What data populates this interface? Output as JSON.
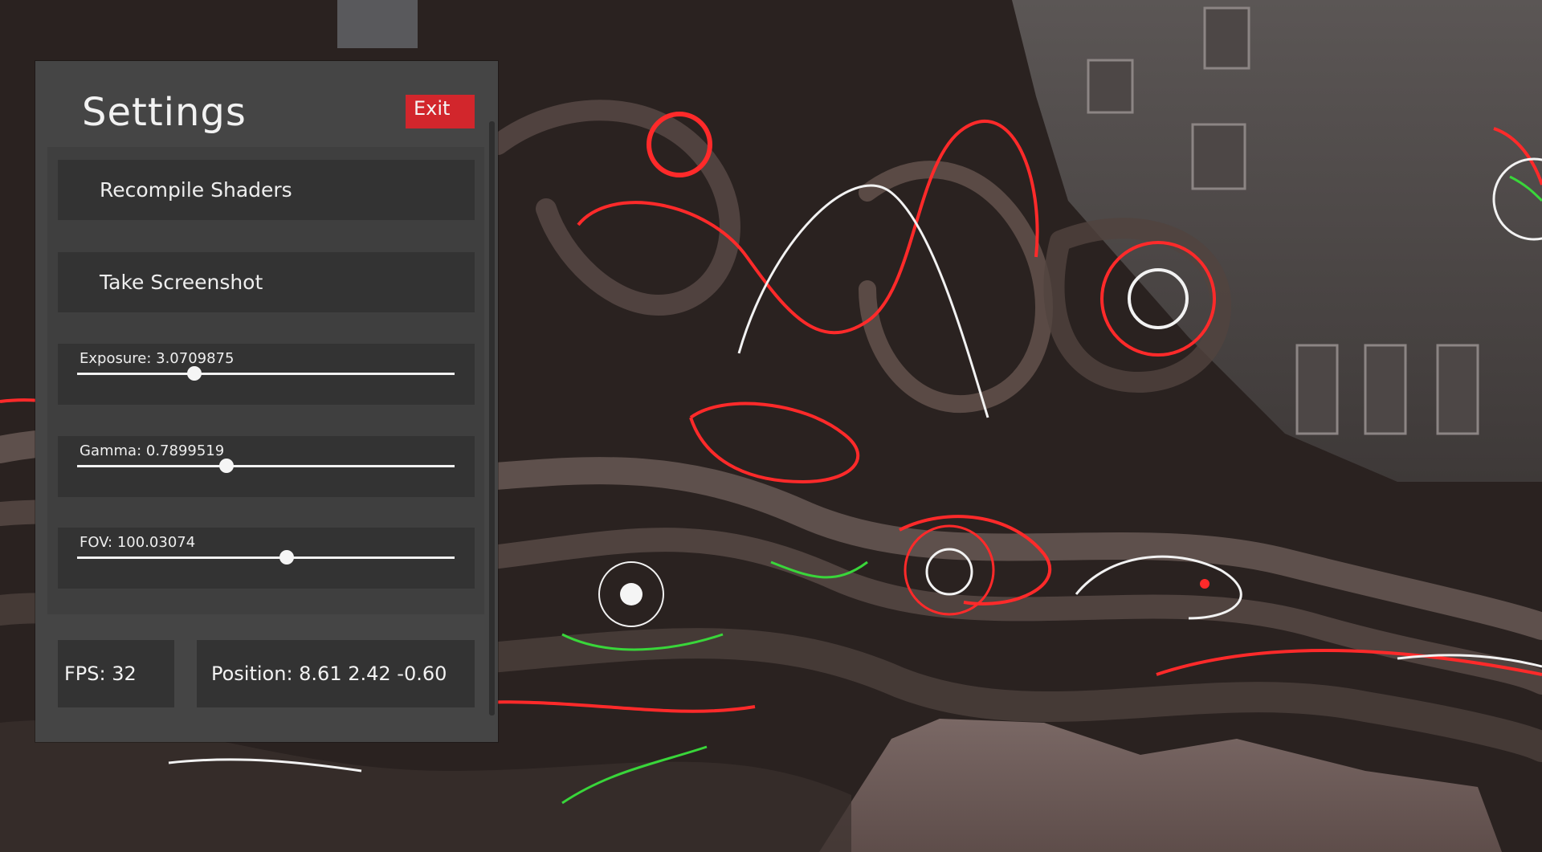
{
  "window": {
    "title": "Settings",
    "exit_label": "Exit"
  },
  "buttons": {
    "recompile_label": "Recompile Shaders",
    "screenshot_label": "Take Screenshot"
  },
  "sliders": [
    {
      "label": "Exposure: 3.0709875",
      "fraction": 0.31
    },
    {
      "label": "Gamma: 0.7899519",
      "fraction": 0.395
    },
    {
      "label": "FOV: 100.03074",
      "fraction": 0.555
    }
  ],
  "stats": {
    "fps_text": "FPS: 32",
    "position_text": "Position: 8.61 2.42 -0.60"
  },
  "colors": {
    "panel_bg": "#454545",
    "control_bg": "#333333",
    "exit_button": "#d2262c",
    "scene_red": "#ff2a2a",
    "scene_green": "#39d63a"
  }
}
